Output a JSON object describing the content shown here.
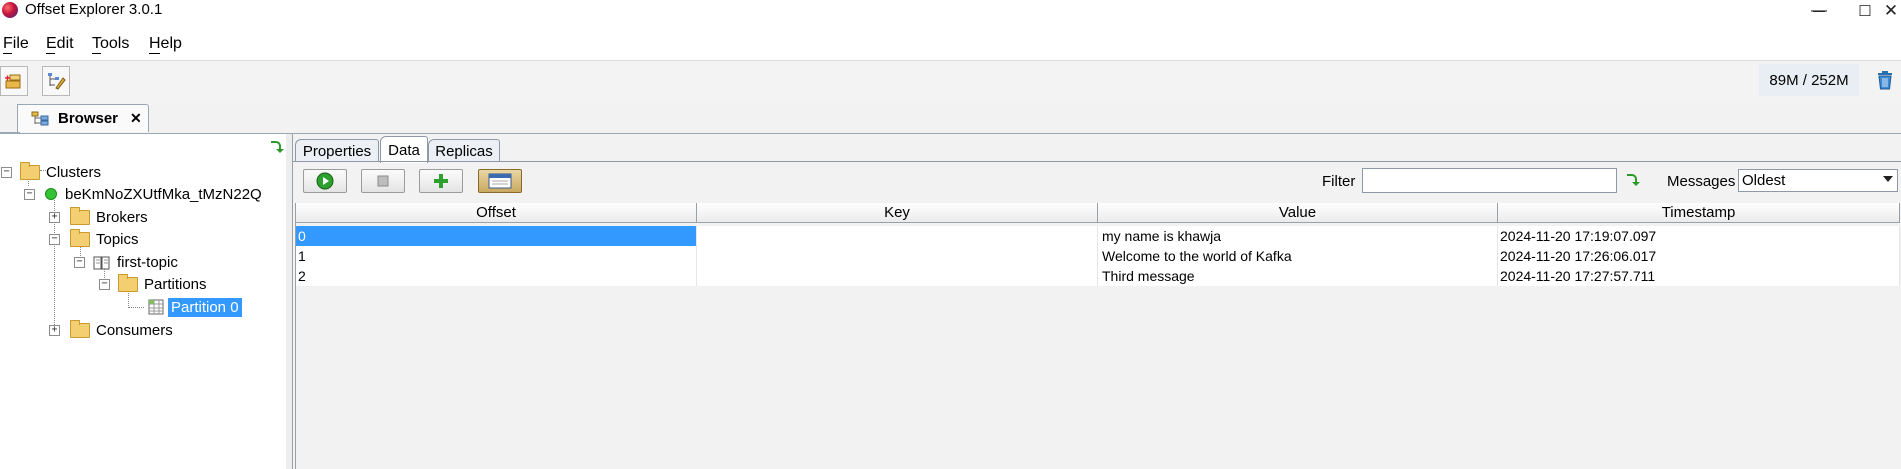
{
  "window": {
    "title": "Offset Explorer  3.0.1",
    "controls": {
      "minimize": "—",
      "maximize": "☐",
      "close": "✕"
    }
  },
  "menu": [
    {
      "label": "File",
      "mnemonic": "F"
    },
    {
      "label": "Edit",
      "mnemonic": "E"
    },
    {
      "label": "Tools",
      "mnemonic": "T"
    },
    {
      "label": "Help",
      "mnemonic": "H"
    }
  ],
  "toolbar": {
    "memory": "89M / 252M"
  },
  "doc_tab": {
    "label": "Browser",
    "close": "✕"
  },
  "tree": {
    "root": "Clusters",
    "cluster": "beKmNoZXUtfMka_tMzN22Q",
    "brokers": "Brokers",
    "topics": "Topics",
    "topic": "first-topic",
    "partitions": "Partitions",
    "partition": "Partition 0",
    "consumers": "Consumers"
  },
  "panel_tabs": [
    "Properties",
    "Data",
    "Replicas"
  ],
  "active_panel_tab": "Data",
  "filter": {
    "label": "Filter",
    "value": ""
  },
  "messages": {
    "label": "Messages",
    "selected": "Oldest"
  },
  "table": {
    "columns": [
      "Offset",
      "Key",
      "Value",
      "Timestamp"
    ],
    "rows": [
      {
        "offset": "0",
        "key": "",
        "value": "my name is khawja",
        "timestamp": "2024-11-20 17:19:07.097"
      },
      {
        "offset": "1",
        "key": "",
        "value": "Welcome to the world of Kafka",
        "timestamp": "2024-11-20 17:26:06.017"
      },
      {
        "offset": "2",
        "key": "",
        "value": "Third message",
        "timestamp": "2024-11-20 17:27:57.711"
      }
    ]
  },
  "colors": {
    "selection": "#3399ff",
    "tree_selection": "#3399ff",
    "folder": "#f4cf72"
  }
}
